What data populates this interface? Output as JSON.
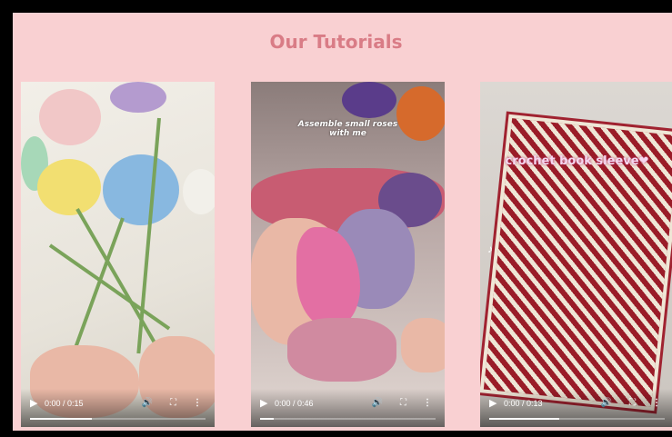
{
  "page": {
    "title": "Our Tutorials"
  },
  "videos": [
    {
      "overlay": "",
      "time": "0:00 / 0:15",
      "progress": 0.35
    },
    {
      "overlay": "Assemble small roses\nwith me",
      "time": "0:00 / 0:46",
      "progress": 0.08
    },
    {
      "overlay": "crochet book sleeve❤",
      "time": "0:00 / 0:13",
      "progress": 0.4
    }
  ],
  "controls": {
    "play_icon": "play-icon",
    "volume_icon": "volume-icon",
    "fullscreen_icon": "fullscreen-icon",
    "more_icon": "more-icon"
  },
  "colors": {
    "background": "#f9d0d2",
    "title": "#d97c86"
  }
}
